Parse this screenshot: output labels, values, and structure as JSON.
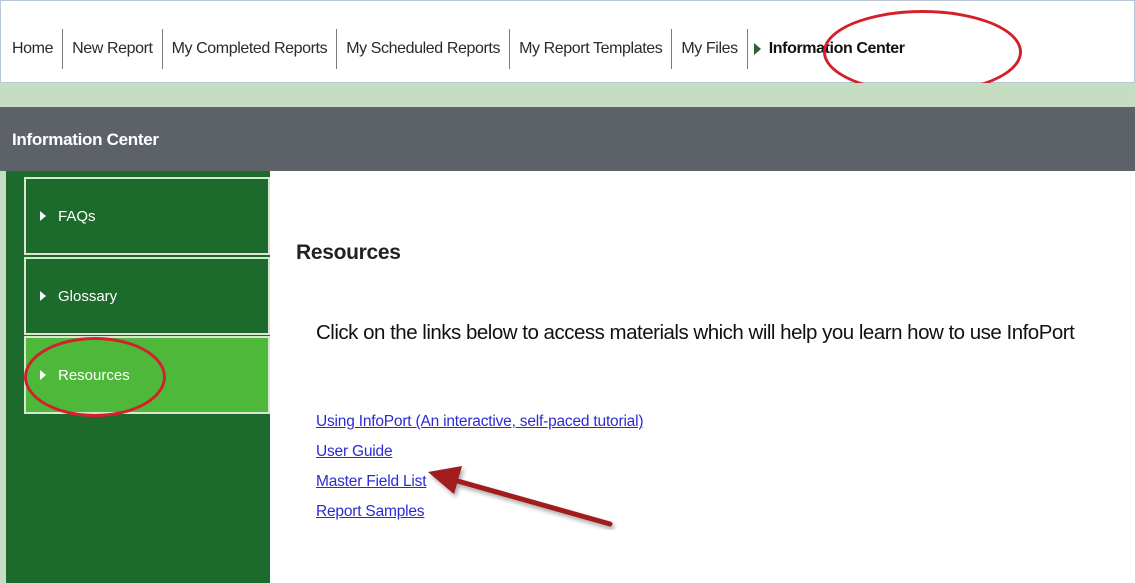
{
  "nav": {
    "tabs": [
      {
        "label": "Home"
      },
      {
        "label": "New Report"
      },
      {
        "label": "My Completed Reports"
      },
      {
        "label": "My Scheduled Reports"
      },
      {
        "label": "My Report Templates"
      },
      {
        "label": "My Files"
      },
      {
        "label": "Information Center",
        "active": true
      }
    ]
  },
  "header": {
    "title": "Information Center"
  },
  "sidebar": {
    "items": [
      {
        "label": "FAQs"
      },
      {
        "label": "Glossary"
      },
      {
        "label": "Resources",
        "selected": true
      }
    ]
  },
  "main": {
    "title": "Resources",
    "intro": "Click on the links below to access materials which will help you learn how to use InfoPort",
    "links": [
      {
        "label": "Using InfoPort (An interactive, self-paced tutorial)"
      },
      {
        "label": "User Guide"
      },
      {
        "label": "Master Field List"
      },
      {
        "label": "Report Samples"
      }
    ]
  },
  "colors": {
    "sidebar_bg": "#1c6b2c",
    "sidebar_selected": "#4db83a",
    "header_bg": "#5d6268",
    "strip": "#c5ddc0",
    "link": "#2b2bd6",
    "annotation": "#d4202a"
  }
}
